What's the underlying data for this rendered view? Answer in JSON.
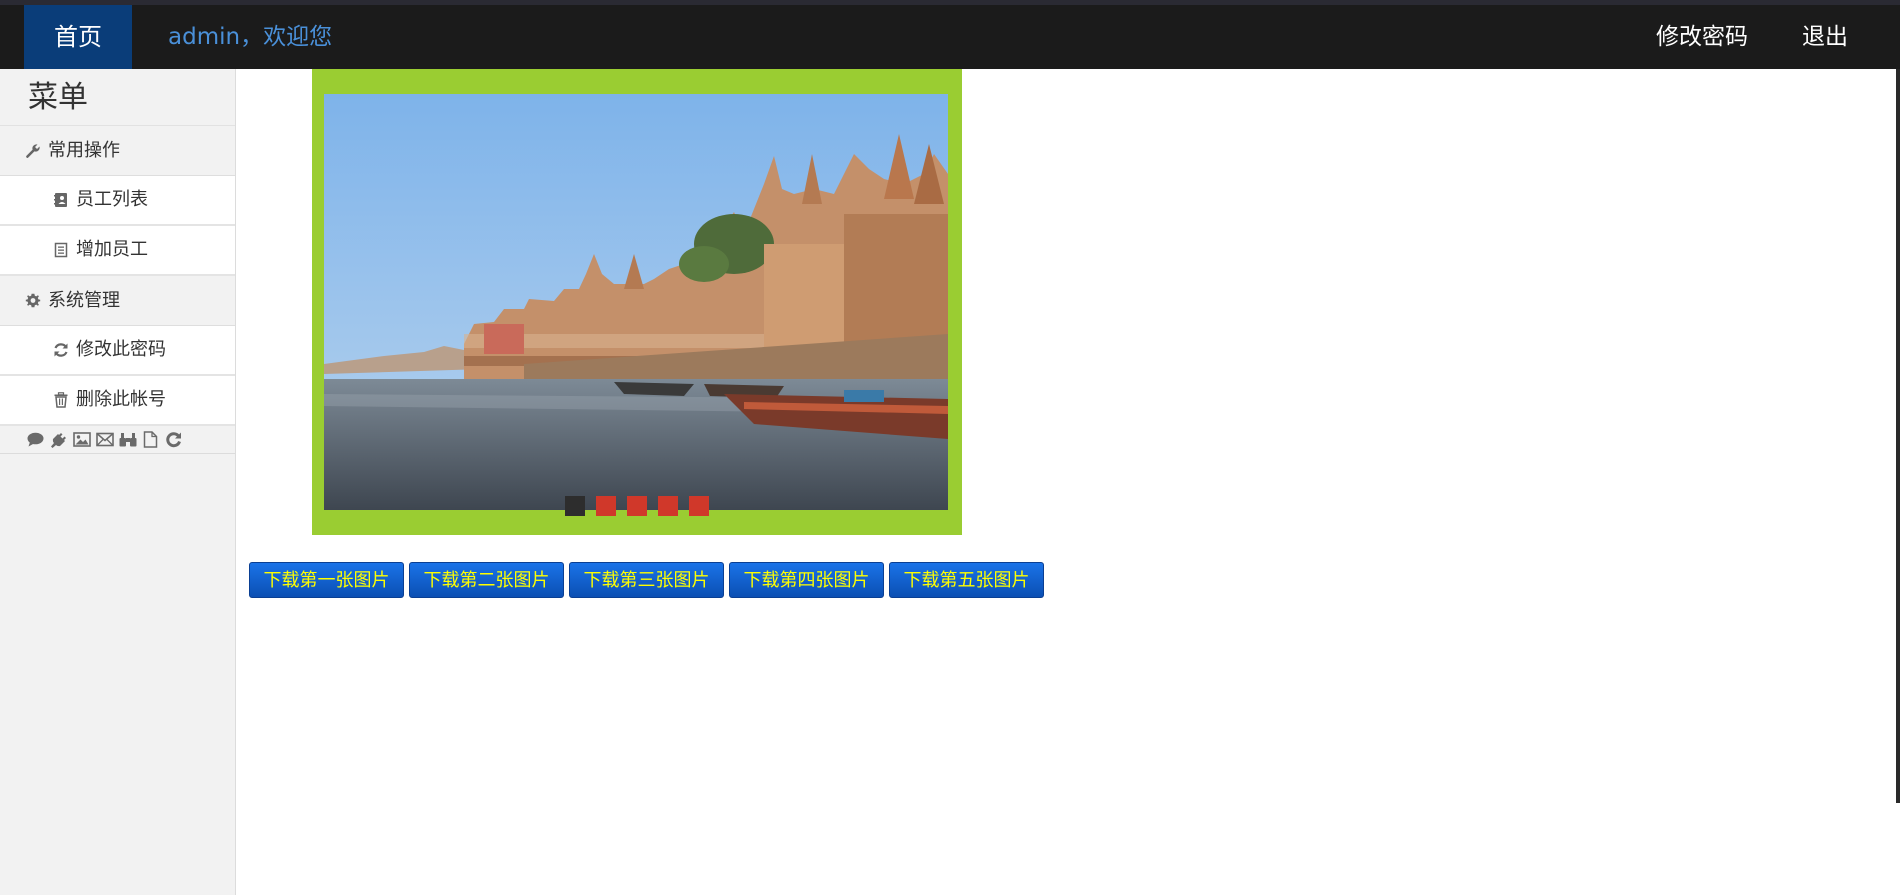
{
  "nav": {
    "home": "首页",
    "welcome": "admin，欢迎您",
    "change_password": "修改密码",
    "logout": "退出"
  },
  "sidebar": {
    "title": "菜单",
    "sections": [
      {
        "label": "常用操作",
        "icon": "wrench-icon",
        "items": [
          {
            "label": "员工列表",
            "icon": "address-book-icon"
          },
          {
            "label": "增加员工",
            "icon": "document-list-icon"
          }
        ]
      },
      {
        "label": "系统管理",
        "icon": "gear-icon",
        "items": [
          {
            "label": "修改此密码",
            "icon": "refresh-icon"
          },
          {
            "label": "删除此帐号",
            "icon": "trash-icon"
          }
        ]
      }
    ],
    "icon_row": [
      "comment-icon",
      "plug-icon",
      "image-icon",
      "envelope-icon",
      "binoculars-icon",
      "file-icon",
      "rotate-icon"
    ]
  },
  "slider": {
    "slide_count": 5,
    "active_index": 0,
    "frame_color": "#9acd32",
    "dot_color": "#d0382a",
    "dot_active_color": "#2d2d2d"
  },
  "downloads": [
    "下载第一张图片",
    "下载第二张图片",
    "下载第三张图片",
    "下载第四张图片",
    "下载第五张图片"
  ],
  "colors": {
    "navbar": "#1b1b1b",
    "home_tab": "#0a3d79",
    "welcome_text": "#4a90d9",
    "button_text": "#ffff00",
    "button_bg": "#1565d8"
  }
}
